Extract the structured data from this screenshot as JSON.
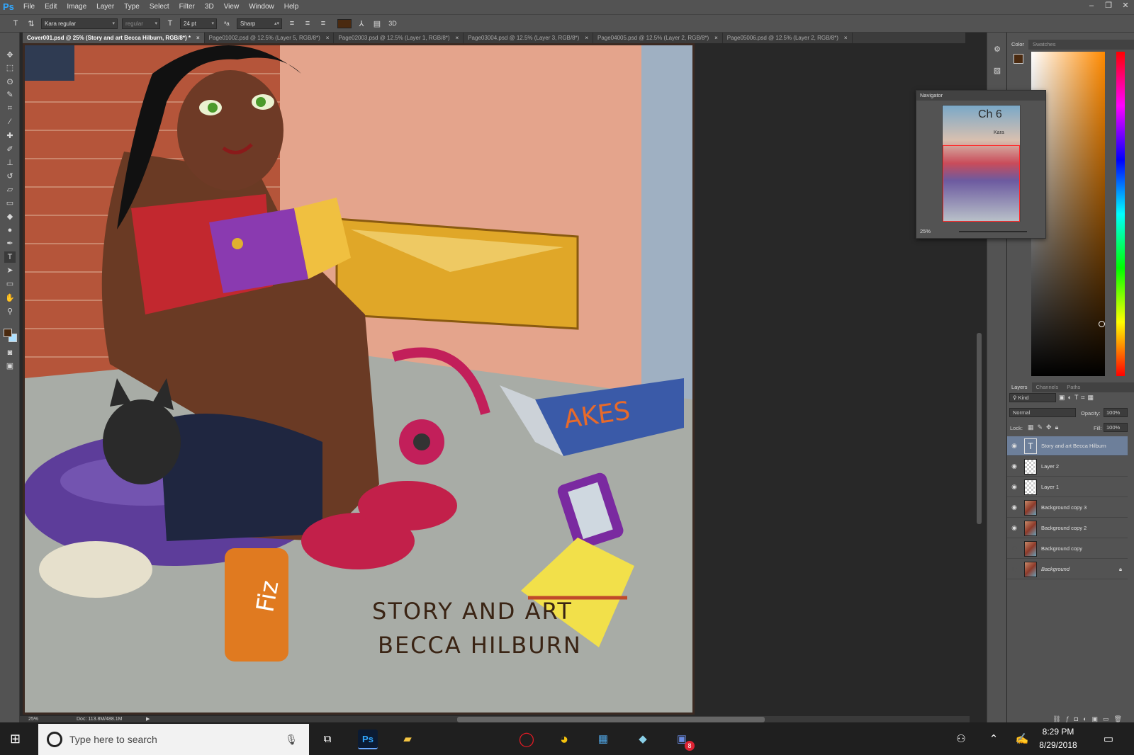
{
  "app": {
    "logo": "Ps"
  },
  "menu": [
    "File",
    "Edit",
    "Image",
    "Layer",
    "Type",
    "Select",
    "Filter",
    "3D",
    "View",
    "Window",
    "Help"
  ],
  "window_controls": [
    "–",
    "❐",
    "✕"
  ],
  "options": {
    "tool_glyph": "T",
    "font_family": "Kara regular",
    "font_style": "regular",
    "font_size": "24 pt",
    "anti_alias": "Sharp",
    "color": "#4a2a10",
    "label_3d": "3D"
  },
  "tabs": [
    {
      "label": "Cover001.psd @ 25% (Story and art Becca Hilburn, RGB/8*) *",
      "active": true
    },
    {
      "label": "Page01002.psd @ 12.5% (Layer 5, RGB/8*)",
      "active": false
    },
    {
      "label": "Page02003.psd @ 12.5% (Layer 1, RGB/8*)",
      "active": false
    },
    {
      "label": "Page03004.psd @ 12.5% (Layer 3, RGB/8*)",
      "active": false
    },
    {
      "label": "Page04005.psd @ 12.5% (Layer 2, RGB/8*)",
      "active": false
    },
    {
      "label": "Page05006.psd @ 12.5% (Layer 2, RGB/8*)",
      "active": false
    }
  ],
  "artwork": {
    "caption_line1": "STORY AND ART",
    "caption_line2": "BECCA HILBURN",
    "box_text": "AKES",
    "can_text": "Fiz"
  },
  "status": {
    "zoom": "25%",
    "doc": "Doc: 113.8M/488.1M"
  },
  "color_panel": {
    "tabs": [
      "Color",
      "Swatches"
    ],
    "foreground": "#4a2a10",
    "background": "#aee0ff"
  },
  "navigator": {
    "title": "Navigator",
    "zoom": "25%",
    "thumb_text": "Ch 6",
    "thumb_text2": "Kara"
  },
  "layers_panel": {
    "tabs": [
      "Layers",
      "Channels",
      "Paths"
    ],
    "kind": "Kind",
    "blend_mode": "Normal",
    "opacity_label": "Opacity:",
    "opacity": "100%",
    "lock_label": "Lock:",
    "fill_label": "Fill:",
    "fill": "100%",
    "layers": [
      {
        "name": "Story and art Becca Hilburn",
        "visible": true,
        "type": "text",
        "selected": true
      },
      {
        "name": "Layer 2",
        "visible": true,
        "type": "transparent",
        "selected": false
      },
      {
        "name": "Layer 1",
        "visible": true,
        "type": "transparent",
        "selected": false
      },
      {
        "name": "Background copy 3",
        "visible": true,
        "type": "image",
        "selected": false
      },
      {
        "name": "Background copy 2",
        "visible": true,
        "type": "image",
        "selected": false
      },
      {
        "name": "Background copy",
        "visible": false,
        "type": "image",
        "selected": false
      },
      {
        "name": "Background",
        "visible": false,
        "type": "image",
        "selected": false,
        "locked": true
      }
    ]
  },
  "taskbar": {
    "search_placeholder": "Type here to search",
    "time": "8:29 PM",
    "date": "8/29/2018",
    "badge": "8"
  }
}
